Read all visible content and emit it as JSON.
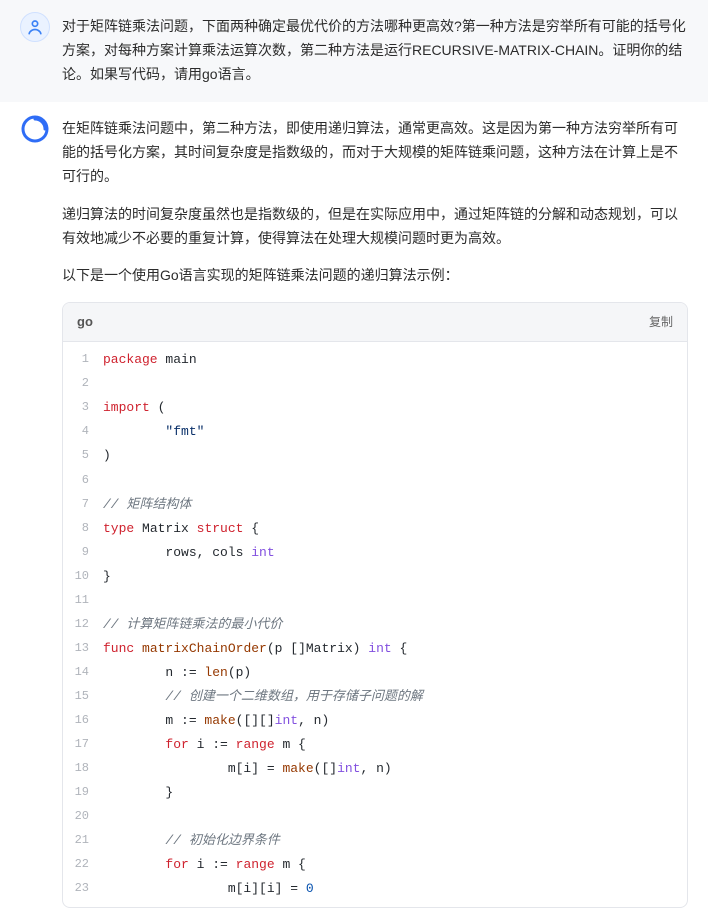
{
  "user": {
    "text": "对于矩阵链乘法问题，下面两种确定最优代价的方法哪种更高效?第一种方法是穷举所有可能的括号化方案，对每种方案计算乘法运算次数，第二种方法是运行RECURSIVE-MATRIX-CHAIN。证明你的结论。如果写代码，请用go语言。"
  },
  "assistant": {
    "p1": "在矩阵链乘法问题中，第二种方法，即使用递归算法，通常更高效。这是因为第一种方法穷举所有可能的括号化方案，其时间复杂度是指数级的，而对于大规模的矩阵链乘问题，这种方法在计算上是不可行的。",
    "p2": "递归算法的时间复杂度虽然也是指数级的，但是在实际应用中，通过矩阵链的分解和动态规划，可以有效地减少不必要的重复计算，使得算法在处理大规模问题时更为高效。",
    "p3": "以下是一个使用Go语言实现的矩阵链乘法问题的递归算法示例：",
    "code": {
      "lang": "go",
      "copy_label": "复制",
      "lines": [
        [
          {
            "t": "kw",
            "s": "package"
          },
          {
            "t": "id",
            "s": " main"
          }
        ],
        [],
        [
          {
            "t": "kw",
            "s": "import"
          },
          {
            "t": "id",
            "s": " ("
          }
        ],
        [
          {
            "t": "id",
            "s": "        "
          },
          {
            "t": "str",
            "s": "\"fmt\""
          }
        ],
        [
          {
            "t": "id",
            "s": ")"
          }
        ],
        [],
        [
          {
            "t": "com",
            "s": "// 矩阵结构体"
          }
        ],
        [
          {
            "t": "kw",
            "s": "type"
          },
          {
            "t": "id",
            "s": " Matrix "
          },
          {
            "t": "kw",
            "s": "struct"
          },
          {
            "t": "id",
            "s": " {"
          }
        ],
        [
          {
            "t": "id",
            "s": "        rows, cols "
          },
          {
            "t": "type",
            "s": "int"
          }
        ],
        [
          {
            "t": "id",
            "s": "}"
          }
        ],
        [],
        [
          {
            "t": "com",
            "s": "// 计算矩阵链乘法的最小代价"
          }
        ],
        [
          {
            "t": "kw",
            "s": "func"
          },
          {
            "t": "id",
            "s": " "
          },
          {
            "t": "func",
            "s": "matrixChainOrder"
          },
          {
            "t": "id",
            "s": "(p []Matrix) "
          },
          {
            "t": "type",
            "s": "int"
          },
          {
            "t": "id",
            "s": " {"
          }
        ],
        [
          {
            "t": "id",
            "s": "        n := "
          },
          {
            "t": "func",
            "s": "len"
          },
          {
            "t": "id",
            "s": "(p)"
          }
        ],
        [
          {
            "t": "id",
            "s": "        "
          },
          {
            "t": "com",
            "s": "// 创建一个二维数组，用于存储子问题的解"
          }
        ],
        [
          {
            "t": "id",
            "s": "        m := "
          },
          {
            "t": "func",
            "s": "make"
          },
          {
            "t": "id",
            "s": "([][]"
          },
          {
            "t": "type",
            "s": "int"
          },
          {
            "t": "id",
            "s": ", n)"
          }
        ],
        [
          {
            "t": "id",
            "s": "        "
          },
          {
            "t": "kw",
            "s": "for"
          },
          {
            "t": "id",
            "s": " i := "
          },
          {
            "t": "kw",
            "s": "range"
          },
          {
            "t": "id",
            "s": " m {"
          }
        ],
        [
          {
            "t": "id",
            "s": "                m[i] = "
          },
          {
            "t": "func",
            "s": "make"
          },
          {
            "t": "id",
            "s": "([]"
          },
          {
            "t": "type",
            "s": "int"
          },
          {
            "t": "id",
            "s": ", n)"
          }
        ],
        [
          {
            "t": "id",
            "s": "        }"
          }
        ],
        [],
        [
          {
            "t": "id",
            "s": "        "
          },
          {
            "t": "com",
            "s": "// 初始化边界条件"
          }
        ],
        [
          {
            "t": "id",
            "s": "        "
          },
          {
            "t": "kw",
            "s": "for"
          },
          {
            "t": "id",
            "s": " i := "
          },
          {
            "t": "kw",
            "s": "range"
          },
          {
            "t": "id",
            "s": " m {"
          }
        ],
        [
          {
            "t": "id",
            "s": "                m[i][i] = "
          },
          {
            "t": "num",
            "s": "0"
          }
        ]
      ]
    }
  }
}
